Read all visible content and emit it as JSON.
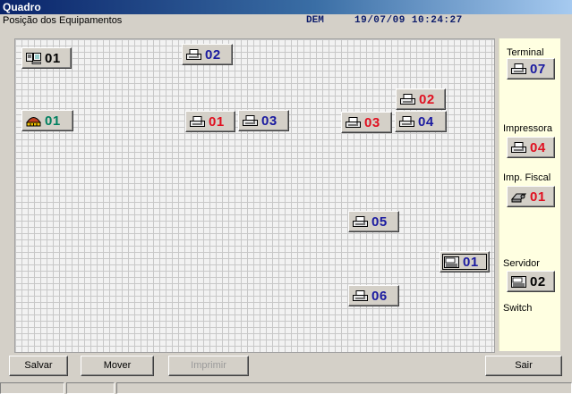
{
  "window": {
    "title": "Quadro"
  },
  "header": {
    "subtitle": "Posição dos Equipamentos",
    "operator": "DEM",
    "datetime": "19/07/09 10:24:27"
  },
  "colors": {
    "blue": "#1a1aa0",
    "red": "#e01020",
    "green": "#008060"
  },
  "devices": [
    {
      "label": "01",
      "icon": "terminal-icon",
      "color": "#000000"
    },
    {
      "label": "02",
      "icon": "printer-icon",
      "color": "#1a1aa0"
    },
    {
      "label": "01",
      "icon": "switch-icon",
      "color": "#008060"
    },
    {
      "label": "01",
      "icon": "printer-icon",
      "color": "#e01020"
    },
    {
      "label": "03",
      "icon": "printer-icon",
      "color": "#1a1aa0"
    },
    {
      "label": "02",
      "icon": "printer-icon",
      "color": "#e01020"
    },
    {
      "label": "03",
      "icon": "printer-icon",
      "color": "#e01020"
    },
    {
      "label": "04",
      "icon": "printer-icon",
      "color": "#1a1aa0"
    },
    {
      "label": "05",
      "icon": "printer-icon",
      "color": "#1a1aa0"
    },
    {
      "label": "01",
      "icon": "server-icon",
      "color": "#1a1aa0"
    },
    {
      "label": "06",
      "icon": "printer-icon",
      "color": "#1a1aa0"
    }
  ],
  "palette": {
    "terminal_label": "Terminal",
    "terminal_count": "07",
    "printer_label": "Impressora",
    "printer_count": "04",
    "fiscal_label": "Imp. Fiscal",
    "fiscal_count": "01",
    "server_label": "Servidor",
    "server_count": "02",
    "switch_label": "Switch"
  },
  "buttons": {
    "save": "Salvar",
    "move": "Mover",
    "print": "Imprimir",
    "exit": "Sair"
  }
}
